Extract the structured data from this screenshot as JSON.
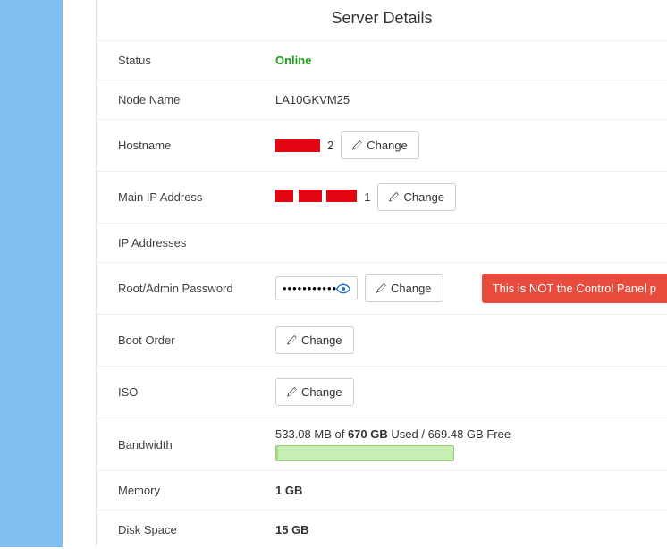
{
  "title": "Server Details",
  "labels": {
    "status": "Status",
    "node": "Node Name",
    "hostname": "Hostname",
    "mainip": "Main IP Address",
    "ips": "IP Addresses",
    "rootpw": "Root/Admin Password",
    "boot": "Boot Order",
    "iso": "ISO",
    "bandwidth": "Bandwidth",
    "memory": "Memory",
    "disk": "Disk Space"
  },
  "values": {
    "status": "Online",
    "node": "LA10GKVM25",
    "hostname_tail": "2",
    "mainip_tail": "1",
    "password_mask": "••••••••••••••",
    "memory": "1 GB",
    "disk": "15 GB"
  },
  "bandwidth": {
    "used": "533.08 MB",
    "of": " of ",
    "total": "670 GB",
    "used_word": " Used / ",
    "free": "669.48 GB Free"
  },
  "button": {
    "change": "Change"
  },
  "warn": "This is NOT the Control Panel p"
}
